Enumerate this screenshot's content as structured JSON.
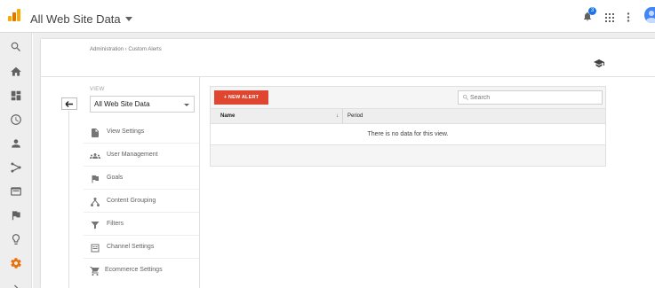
{
  "header": {
    "account_title": "All Web Site Data",
    "notification_count": "3",
    "breadcrumb": "Administration › Custom Alerts"
  },
  "rail": {
    "icons": [
      "search-icon",
      "home-icon",
      "customization-icon",
      "clock-icon",
      "person-icon",
      "acquisition-icon",
      "behavior-icon",
      "flag-icon",
      "lightbulb-icon",
      "gear-icon",
      "expand-icon"
    ],
    "active_color": "#e8710a"
  },
  "view": {
    "label": "VIEW",
    "selected": "All Web Site Data"
  },
  "admin_items": [
    {
      "label": "View Settings",
      "icon": "document-icon"
    },
    {
      "label": "User Management",
      "icon": "users-icon"
    },
    {
      "label": "Goals",
      "icon": "flag-icon"
    },
    {
      "label": "Content Grouping",
      "icon": "content-grouping-icon"
    },
    {
      "label": "Filters",
      "icon": "filter-icon"
    },
    {
      "label": "Channel Settings",
      "icon": "channel-icon"
    },
    {
      "label": "Ecommerce Settings",
      "icon": "cart-icon"
    }
  ],
  "alerts": {
    "new_alert_label": "+ NEW ALERT",
    "search_placeholder": "Search",
    "columns": {
      "name": "Name",
      "period": "Period"
    },
    "sort_indicator": "↓",
    "empty_message": "There is no data for this view."
  },
  "colors": {
    "accent": "#e0452f",
    "logo": [
      "#f9ab00",
      "#e37400",
      "#f9ab00"
    ],
    "notification_badge": "#1a73e8"
  }
}
